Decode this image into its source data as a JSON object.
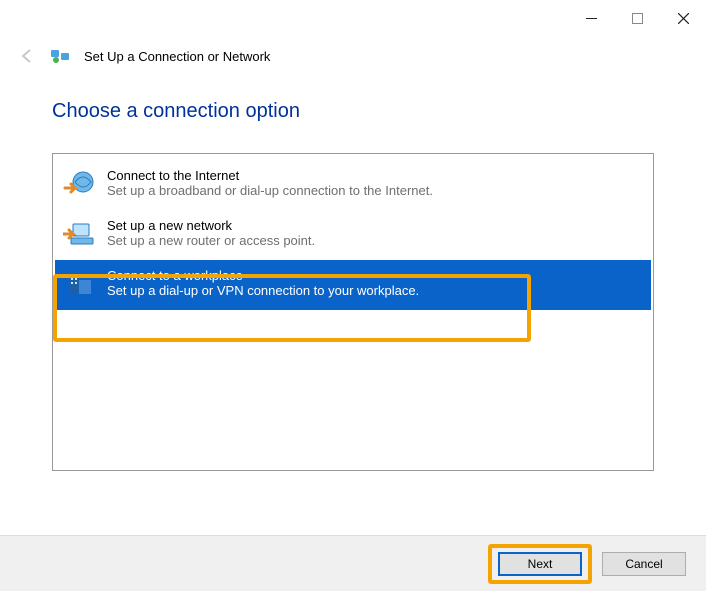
{
  "window": {
    "title": "Set Up a Connection or Network"
  },
  "instruction": "Choose a connection option",
  "options": [
    {
      "title": "Connect to the Internet",
      "desc": "Set up a broadband or dial-up connection to the Internet."
    },
    {
      "title": "Set up a new network",
      "desc": "Set up a new router or access point."
    },
    {
      "title": "Connect to a workplace",
      "desc": "Set up a dial-up or VPN connection to your workplace."
    }
  ],
  "buttons": {
    "next": "Next",
    "cancel": "Cancel"
  }
}
